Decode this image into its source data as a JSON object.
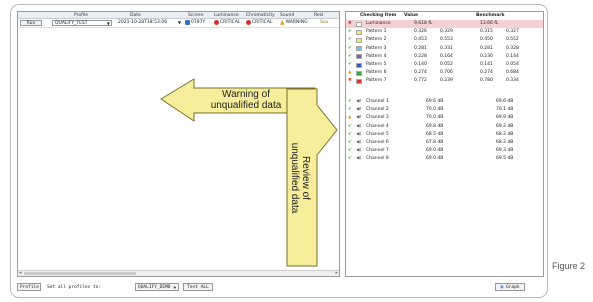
{
  "figure_label": "Figure 2",
  "left": {
    "headers": [
      "Profile",
      "Date",
      "Screen",
      "Luminance",
      "Chromaticity",
      "Sound",
      "Resl"
    ],
    "row": {
      "run_label": "Run",
      "profile": "QUALIFY_TEST",
      "date": "2021-10-28T18:53:06",
      "screen_status": "0787Y",
      "luminance_status": "CRITICAL",
      "chromaticity_status": "CRITICAL",
      "sound_status": "WARNING",
      "resl": "Sou"
    }
  },
  "right": {
    "headers": [
      "Checking Item",
      "Value",
      "Benchmark"
    ],
    "rows": [
      {
        "status": "error",
        "swatch": "#ffffff",
        "name": "Luminance",
        "v1": "9.618 fL",
        "v2": "",
        "b1": "13.66 fL",
        "b2": ""
      },
      {
        "status": "ok",
        "swatch": "#f1ee5a",
        "name": "Pattern 1",
        "v1": "0.326",
        "v2": "0.329",
        "b1": "0.315",
        "b2": "0.327"
      },
      {
        "status": "ok",
        "swatch": "#f1ee5a",
        "name": "Pattern 2",
        "v1": "0.453",
        "v2": "0.553",
        "b1": "0.450",
        "b2": "0.552"
      },
      {
        "status": "ok",
        "swatch": "#66ccee",
        "name": "Pattern 3",
        "v1": "0.281",
        "v2": "0.331",
        "b1": "0.281",
        "b2": "0.328"
      },
      {
        "status": "ok",
        "swatch": "#7a5fb0",
        "name": "Pattern 4",
        "v1": "0.228",
        "v2": "0.164",
        "b1": "0.230",
        "b2": "0.144"
      },
      {
        "status": "ok",
        "swatch": "#2e58c8",
        "name": "Pattern 5",
        "v1": "0.140",
        "v2": "0.052",
        "b1": "0.141",
        "b2": "0.054"
      },
      {
        "status": "warn",
        "swatch": "#3aa83a",
        "name": "Pattern 6",
        "v1": "0.274",
        "v2": "0.706",
        "b1": "0.274",
        "b2": "0.684"
      },
      {
        "status": "error",
        "swatch": "#d53030",
        "name": "Pattern 7",
        "v1": "0.772",
        "v2": "0.239",
        "b1": "0.780",
        "b2": "0.334"
      }
    ],
    "channels": [
      {
        "status": "ok",
        "name": "Channel 1",
        "value": "69.6 dB",
        "bench": "69.6 dB"
      },
      {
        "status": "ok",
        "name": "Channel 2",
        "value": "70.0 dB",
        "bench": "70.1 dB"
      },
      {
        "status": "warn",
        "name": "Channel 3",
        "value": "70.0 dB",
        "bench": "69.9 dB"
      },
      {
        "status": "ok",
        "name": "Channel 4",
        "value": "69.8 dB",
        "bench": "69.2 dB"
      },
      {
        "status": "ok",
        "name": "Channel 5",
        "value": "68.5 dB",
        "bench": "68.2 dB"
      },
      {
        "status": "ok",
        "name": "Channel 6",
        "value": "67.8 dB",
        "bench": "68.2 dB"
      },
      {
        "status": "ok",
        "name": "Channel 7",
        "value": "69.0 dB",
        "bench": "69.3 dB"
      },
      {
        "status": "ok",
        "name": "Channel 8",
        "value": "69.0 dB",
        "bench": "69.5 dB"
      }
    ]
  },
  "bottom": {
    "profile_button": "Profile",
    "set_label": "Set all profiles to:",
    "set_value": "QUALIFY_DEMO",
    "test_all_button": "Test ALL",
    "graph_button": "Graph"
  },
  "callouts": {
    "warning_line1": "Warning of",
    "warning_line2": "unqualified data",
    "review_line1": "Review of",
    "review_line2": "unqualified data"
  },
  "colors": {
    "ok": "#3a9a2a",
    "error": "#d8312a",
    "warning": "#e0a020",
    "callout_fill": "#f6ee9a",
    "selected_row": "#cfe3f7"
  }
}
